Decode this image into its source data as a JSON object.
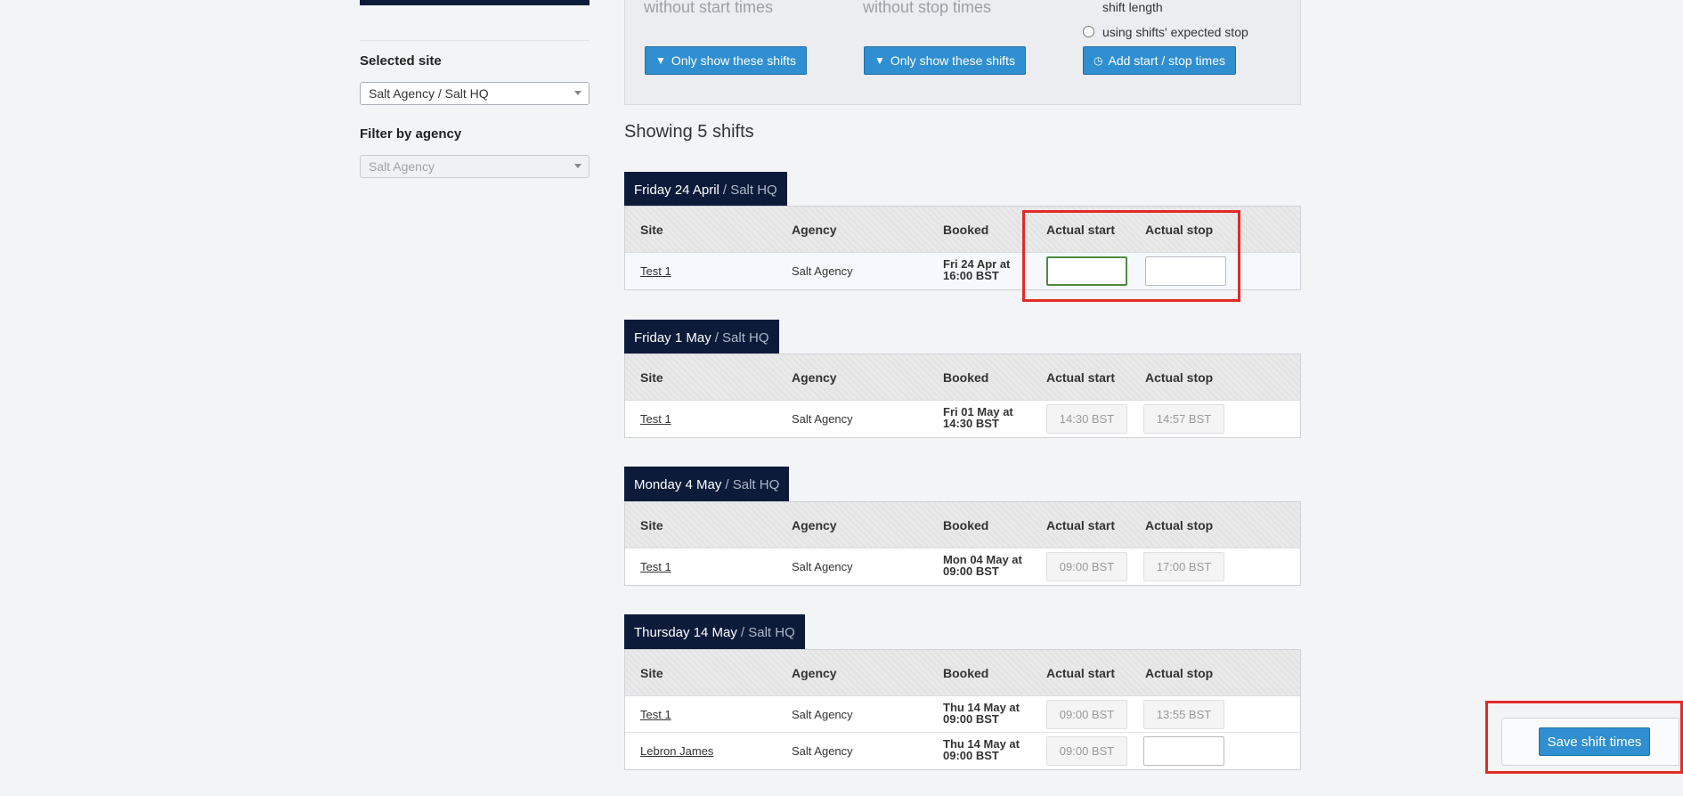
{
  "sidebar": {
    "selected_site_label": "Selected site",
    "selected_site_value": "Salt Agency / Salt HQ",
    "filter_agency_label": "Filter by agency",
    "filter_agency_value": "Salt Agency"
  },
  "filters": {
    "col1_heading": "without start times",
    "col2_heading": "without stop times",
    "col3_text": "shift length",
    "col3_radio_label": "using shifts' expected stop",
    "col1_button": "Only show these shifts",
    "col2_button": "Only show these shifts",
    "col3_button": "Add start / stop times"
  },
  "showing_text": "Showing 5 shifts",
  "columns": {
    "site": "Site",
    "agency": "Agency",
    "booked": "Booked",
    "actual_start": "Actual start",
    "actual_stop": "Actual stop"
  },
  "days": [
    {
      "date": "Friday 24 April",
      "site_suffix": "/ Salt HQ",
      "rows": [
        {
          "site": "Test 1",
          "agency": "Salt Agency",
          "booked_line1": "Fri 24 Apr at",
          "booked_line2": "16:00 BST",
          "actual_start": "",
          "actual_stop": ""
        }
      ]
    },
    {
      "date": "Friday 1 May",
      "site_suffix": "/ Salt HQ",
      "rows": [
        {
          "site": "Test 1",
          "agency": "Salt Agency",
          "booked_line1": "Fri 01 May at",
          "booked_line2": "14:30 BST",
          "actual_start": "14:30 BST",
          "actual_stop": "14:57 BST"
        }
      ]
    },
    {
      "date": "Monday 4 May",
      "site_suffix": "/ Salt HQ",
      "rows": [
        {
          "site": "Test 1",
          "agency": "Salt Agency",
          "booked_line1": "Mon 04 May at",
          "booked_line2": "09:00 BST",
          "actual_start": "09:00 BST",
          "actual_stop": "17:00 BST"
        }
      ]
    },
    {
      "date": "Thursday 14 May",
      "site_suffix": "/ Salt HQ",
      "rows": [
        {
          "site": "Test 1",
          "agency": "Salt Agency",
          "booked_line1": "Thu 14 May at",
          "booked_line2": "09:00 BST",
          "actual_start": "09:00 BST",
          "actual_stop": "13:55 BST"
        },
        {
          "site": "Lebron James",
          "agency": "Salt Agency",
          "booked_line1": "Thu 14 May at",
          "booked_line2": "09:00 BST",
          "actual_start": "09:00 BST",
          "actual_stop": ""
        }
      ]
    }
  ],
  "save_button": "Save shift times",
  "colors": {
    "navy": "#0d1b3a",
    "button_blue": "#2f8fd0",
    "annotation_red": "#e12a2a",
    "focus_green": "#4e8a3d"
  }
}
